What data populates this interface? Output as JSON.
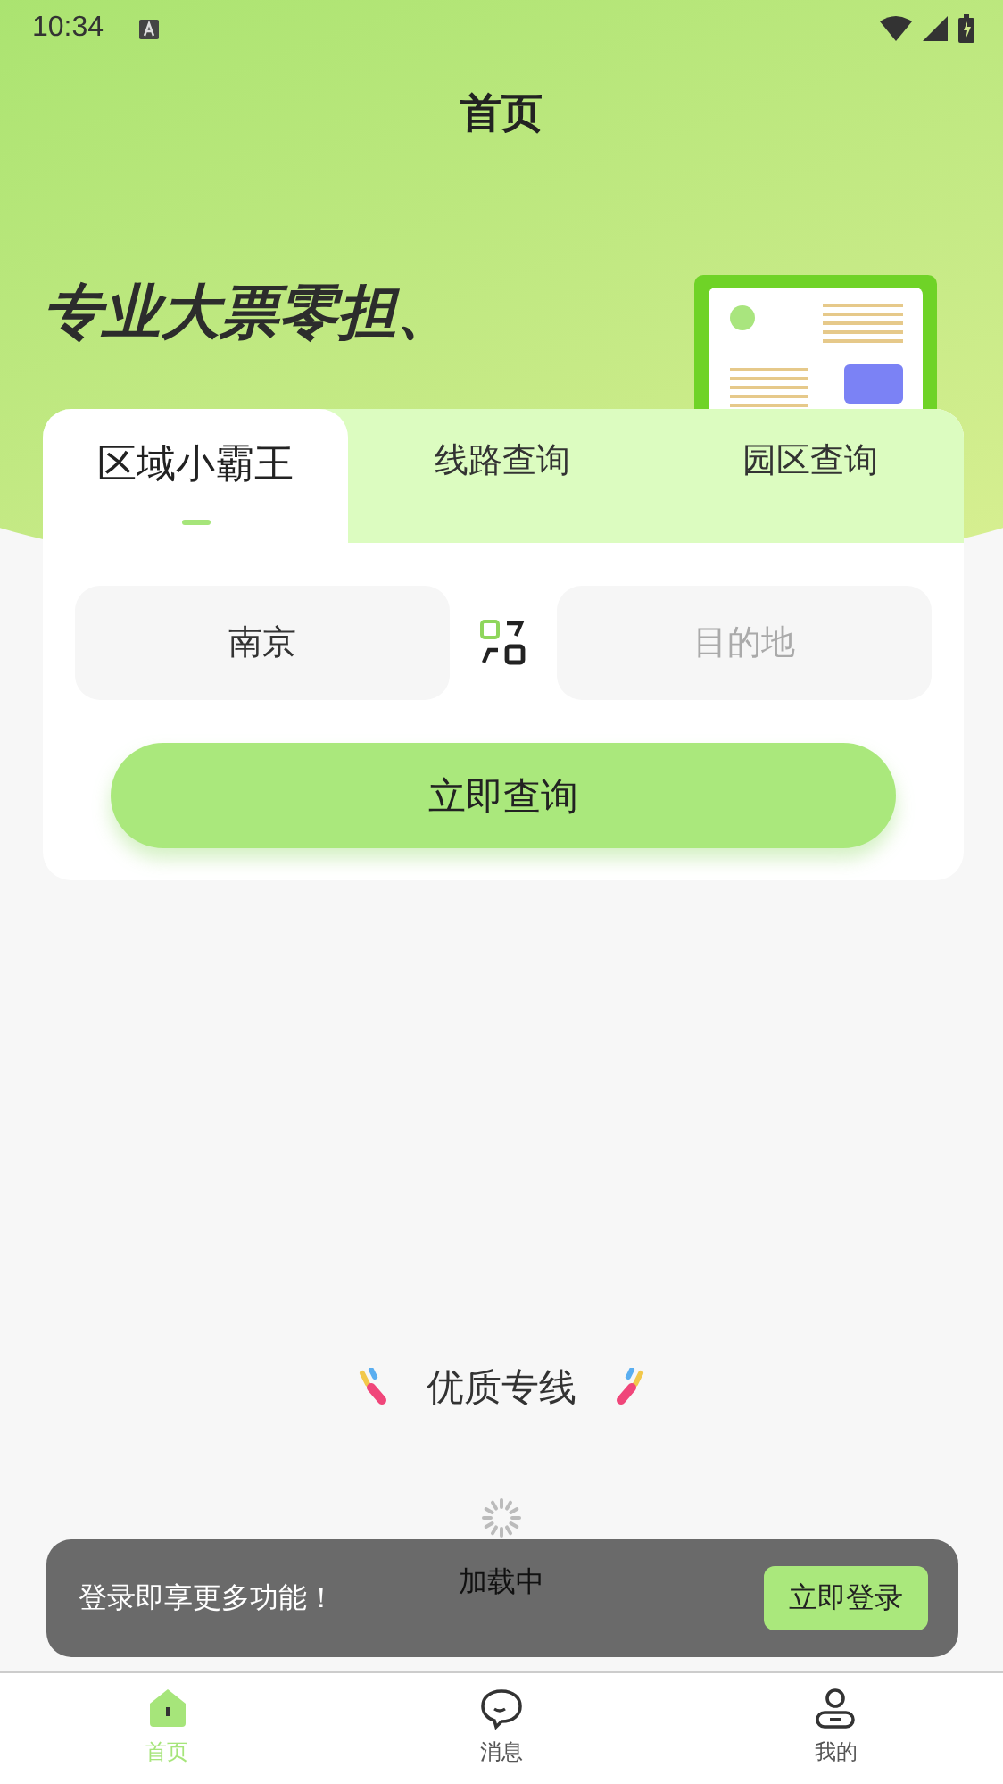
{
  "status_bar": {
    "time": "10:34"
  },
  "header": {
    "title": "首页"
  },
  "banner": {
    "lines": [
      "专业大票零担、"
    ]
  },
  "tabs": [
    {
      "label": "区域小霸王",
      "selected": true
    },
    {
      "label": "线路查询",
      "selected": false
    },
    {
      "label": "园区查询",
      "selected": false
    }
  ],
  "route": {
    "origin": {
      "value": "南京"
    },
    "destination": {
      "placeholder": "目的地"
    }
  },
  "query_button": "立即查询",
  "section_title": "优质专线",
  "loading": "加载中",
  "toast": {
    "message": "登录即享更多功能！",
    "button": "立即登录"
  },
  "bottom_nav": [
    {
      "label": "首页",
      "selected": true
    },
    {
      "label": "消息",
      "selected": false
    },
    {
      "label": "我的",
      "selected": false
    }
  ]
}
